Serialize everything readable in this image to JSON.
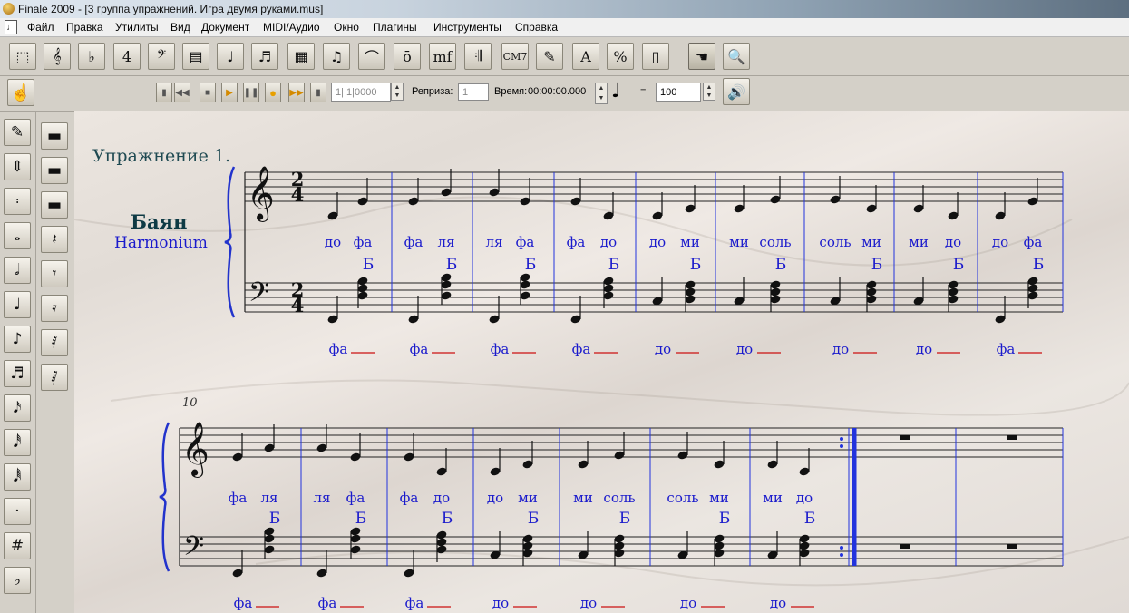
{
  "window": {
    "title": "Finale 2009 - [3 группа упражнений. Игра двумя руками.mus]"
  },
  "menu": [
    "Файл",
    "Правка",
    "Утилиты",
    "Вид",
    "Документ",
    "MIDI/Аудио",
    "Окно",
    "Плагины",
    "Инструменты",
    "Справка"
  ],
  "toolbar": {
    "tools": [
      {
        "name": "selection-tool",
        "icon": "⬚"
      },
      {
        "name": "staff-tool",
        "icon": "𝄞"
      },
      {
        "name": "key-signature-tool",
        "icon": "♭"
      },
      {
        "name": "time-signature-tool",
        "icon": "4"
      },
      {
        "name": "clef-tool",
        "icon": "𝄢"
      },
      {
        "name": "measure-tool",
        "icon": "▤"
      },
      {
        "name": "simple-entry-tool",
        "icon": "♩"
      },
      {
        "name": "speedy-entry-tool",
        "icon": "♬"
      },
      {
        "name": "hyperscribe-tool",
        "icon": "▦"
      },
      {
        "name": "tuplet-tool",
        "icon": "♫"
      },
      {
        "name": "smart-shape-tool",
        "icon": "⌒"
      },
      {
        "name": "articulation-tool",
        "icon": "ō"
      },
      {
        "name": "expression-tool",
        "icon": "mf"
      },
      {
        "name": "repeat-tool",
        "icon": "𝄇"
      },
      {
        "name": "chord-tool",
        "icon": "CM7"
      },
      {
        "name": "lyrics-tool",
        "icon": "✎"
      },
      {
        "name": "text-tool",
        "icon": "A"
      },
      {
        "name": "resize-tool",
        "icon": "%"
      },
      {
        "name": "page-layout-tool",
        "icon": "▯"
      },
      {
        "name": "hand-grabber-tool",
        "icon": "☚"
      },
      {
        "name": "zoom-tool",
        "icon": "🔍"
      }
    ]
  },
  "playback": {
    "counter": "1| 1|0000",
    "repeat_label": "Репризa:",
    "repeat_value": "1",
    "time_label": "Время:",
    "time_value": "00:00:00.000",
    "tempo_note": "♩",
    "tempo_eq": "=",
    "tempo_value": "100"
  },
  "palette": {
    "left": [
      "✎",
      "⇕",
      "𝄈",
      "𝅝",
      "𝅗𝅥",
      "♩",
      "♪",
      "♬",
      "𝅘𝅥𝅯",
      "𝅘𝅥𝅰",
      "𝅘𝅥𝅱",
      "·",
      "#",
      "♭"
    ],
    "right": [
      "▬",
      "▬",
      "▬",
      "𝄽",
      "𝄾",
      "𝄿",
      "𝅀",
      "𝅁"
    ]
  },
  "score": {
    "exercise_title": "Упражнение 1.",
    "instrument_name": "Баян",
    "instrument_name_en": "Harmonium",
    "time_signature": [
      "2",
      "4"
    ],
    "measure_number_sys2": "10",
    "bass_marker": "Б",
    "system1": {
      "treble_lyrics": [
        [
          "до",
          "фа"
        ],
        [
          "фа",
          "ля"
        ],
        [
          "ля",
          "фа"
        ],
        [
          "фа",
          "до"
        ],
        [
          "до",
          "ми"
        ],
        [
          "ми",
          "соль"
        ],
        [
          "соль",
          "ми"
        ],
        [
          "ми",
          "до"
        ],
        [
          "до",
          "фа"
        ]
      ],
      "bass_lyrics": [
        "фа",
        "фа",
        "фа",
        "фа",
        "до",
        "до",
        "до",
        "до",
        "фа"
      ]
    },
    "system2": {
      "treble_lyrics": [
        [
          "фа",
          "ля"
        ],
        [
          "ля",
          "фа"
        ],
        [
          "фа",
          "до"
        ],
        [
          "до",
          "ми"
        ],
        [
          "ми",
          "соль"
        ],
        [
          "соль",
          "ми"
        ],
        [
          "ми",
          "до"
        ]
      ],
      "bass_lyrics": [
        "фа",
        "фа",
        "фа",
        "до",
        "до",
        "до",
        "до"
      ]
    },
    "colors": {
      "lyric": "#1a1acc",
      "barline": "#2233dd",
      "extender": "#cc1111",
      "title": "#1f4a52",
      "instrument": "#0e3a44"
    }
  }
}
